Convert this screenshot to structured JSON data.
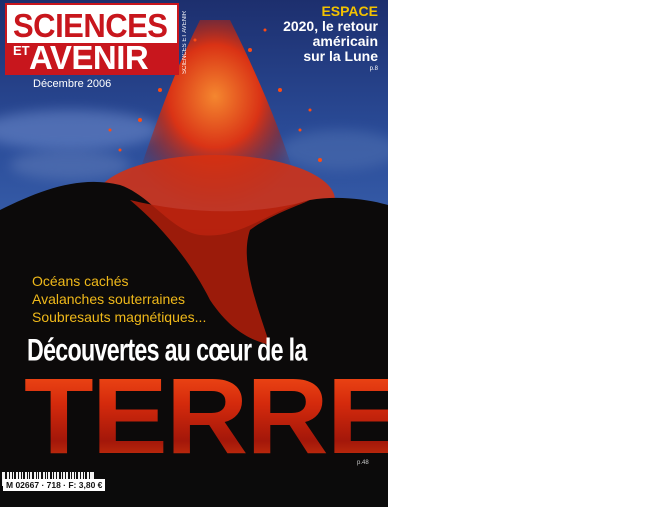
{
  "masthead": {
    "line1": "SCIENCES",
    "et": "ET",
    "line2": "AVENIR",
    "spine": "SCIENCES ET AVENIR"
  },
  "issue_date": "Décembre 2006",
  "space_teaser": {
    "kicker": "ESPACE",
    "lines": [
      "2020, le retour",
      "américain",
      "sur la Lune"
    ],
    "page": "p.8"
  },
  "teasers": [
    "Océans cachés",
    "Avalanches souterraines",
    "Soubresauts magnétiques..."
  ],
  "headline": "Découvertes au cœur de la",
  "big_word": "TERRE",
  "big_word_page": "p.48",
  "price_label": "M 02667 · 718 · F: 3,80 €",
  "colors": {
    "brand_red": "#c8161d",
    "teaser_yellow": "#f0b91a",
    "lava": "#d42a0c"
  }
}
